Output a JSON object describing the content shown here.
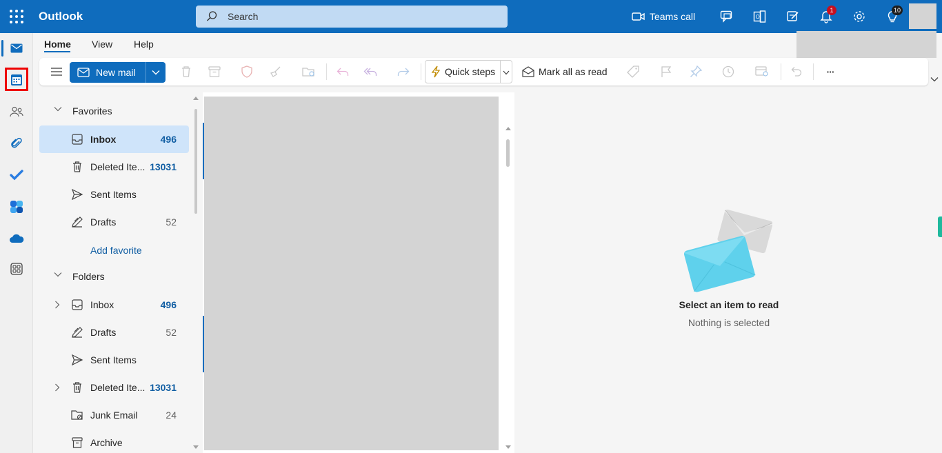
{
  "header": {
    "app_name": "Outlook",
    "search_placeholder": "Search",
    "teams_call_label": "Teams call",
    "notifications_badge": "1",
    "tips_badge": "10",
    "accent_color": "#0f6cbd"
  },
  "tabs": [
    {
      "label": "Home",
      "active": true
    },
    {
      "label": "View",
      "active": false
    },
    {
      "label": "Help",
      "active": false
    }
  ],
  "ribbon": {
    "new_mail_label": "New mail",
    "quick_steps_label": "Quick steps",
    "mark_all_read_label": "Mark all as read",
    "more_label": "···"
  },
  "rail": [
    {
      "icon": "mail-icon",
      "active": true
    },
    {
      "icon": "calendar-icon",
      "highlighted": true
    },
    {
      "icon": "people-icon"
    },
    {
      "icon": "attachment-icon"
    },
    {
      "icon": "todo-check-icon"
    },
    {
      "icon": "apps-hub-icon"
    },
    {
      "icon": "onedrive-cloud-icon"
    },
    {
      "icon": "more-apps-icon"
    }
  ],
  "folders": {
    "favorites_title": "Favorites",
    "favorites": [
      {
        "label": "Inbox",
        "count": "496",
        "icon": "inbox-icon",
        "selected": true
      },
      {
        "label": "Deleted Ite...",
        "count": "13031",
        "icon": "trash-icon"
      },
      {
        "label": "Sent Items",
        "count": "",
        "icon": "send-icon"
      },
      {
        "label": "Drafts",
        "count": "52",
        "icon": "drafts-icon"
      }
    ],
    "add_favorite_label": "Add favorite",
    "folders_title": "Folders",
    "folders": [
      {
        "label": "Inbox",
        "count": "496",
        "icon": "inbox-icon",
        "expandable": true
      },
      {
        "label": "Drafts",
        "count": "52",
        "icon": "drafts-icon"
      },
      {
        "label": "Sent Items",
        "count": "",
        "icon": "send-icon"
      },
      {
        "label": "Deleted Ite...",
        "count": "13031",
        "icon": "trash-icon",
        "expandable": true
      },
      {
        "label": "Junk Email",
        "count": "24",
        "icon": "junk-icon"
      },
      {
        "label": "Archive",
        "count": "",
        "icon": "archive-icon"
      }
    ]
  },
  "reading_pane": {
    "title": "Select an item to read",
    "subtitle": "Nothing is selected"
  }
}
